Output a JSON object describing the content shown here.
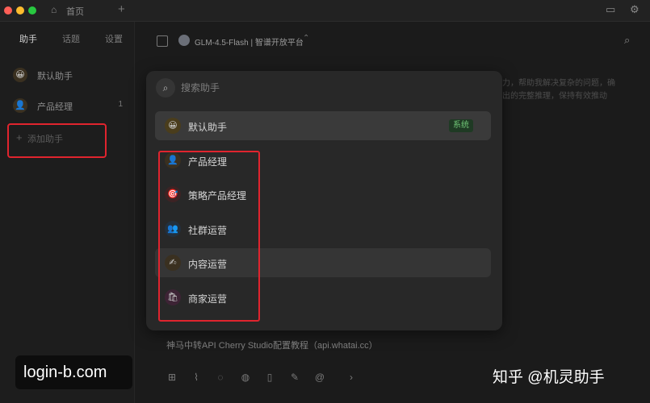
{
  "titlebar": {
    "home_tab": "首页",
    "new_tab": "+"
  },
  "sidebar": {
    "tabs": [
      "助手",
      "话题",
      "设置"
    ],
    "assistants": [
      {
        "emoji": "😀",
        "label": "默认助手",
        "count": ""
      },
      {
        "emoji": "👤",
        "label": "产品经理",
        "count": "1"
      }
    ],
    "add_label": "添加助手"
  },
  "header": {
    "model": "GLM-4.5-Flash | 智谱开放平台"
  },
  "background_text": {
    "line1": "力，帮助我解决复杂的问题，确",
    "line2": "出的完整推理，保持有效推动"
  },
  "popup": {
    "search_placeholder": "搜索助手",
    "default_item": {
      "emoji": "😀",
      "name": "默认助手",
      "badge": "系统"
    },
    "items": [
      {
        "emoji": "👤",
        "name": "产品经理",
        "bg": "#3a3020"
      },
      {
        "emoji": "🎯",
        "name": "策略产品经理",
        "bg": "#3d2324"
      },
      {
        "emoji": "👥",
        "name": "社群运营",
        "bg": "#23303d"
      },
      {
        "emoji": "✍",
        "name": "内容运营",
        "bg": "#3a3020"
      },
      {
        "emoji": "🛍",
        "name": "商家运营",
        "bg": "#3d2335"
      }
    ]
  },
  "bottom": {
    "input_hint": "神马中转API Cherry Studio配置教程（api.whatai.cc）",
    "watermark_left": "login-b.com",
    "watermark_right": "知乎 @机灵助手"
  }
}
